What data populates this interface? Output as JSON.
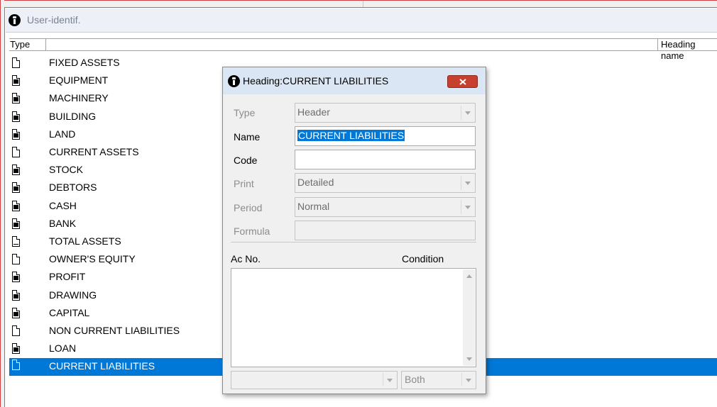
{
  "window": {
    "title": "User-identif."
  },
  "list": {
    "columns": {
      "type": "Type",
      "heading_name": "Heading name"
    },
    "rows": [
      {
        "label": "FIXED ASSETS",
        "icon": "header-doc-icon"
      },
      {
        "label": "EQUIPMENT",
        "icon": "detail-doc-icon"
      },
      {
        "label": "MACHINERY",
        "icon": "detail-doc-icon"
      },
      {
        "label": "BUILDING",
        "icon": "detail-doc-icon"
      },
      {
        "label": "LAND",
        "icon": "detail-doc-icon"
      },
      {
        "label": "CURRENT ASSETS",
        "icon": "header-doc-icon"
      },
      {
        "label": "STOCK",
        "icon": "detail-doc-icon"
      },
      {
        "label": "DEBTORS",
        "icon": "detail-doc-icon"
      },
      {
        "label": "CASH",
        "icon": "detail-doc-icon"
      },
      {
        "label": "BANK",
        "icon": "detail-doc-icon"
      },
      {
        "label": "TOTAL ASSETS",
        "icon": "total-doc-icon"
      },
      {
        "label": "OWNER'S EQUITY",
        "icon": "header-doc-icon"
      },
      {
        "label": "PROFIT",
        "icon": "detail-doc-icon"
      },
      {
        "label": "DRAWING",
        "icon": "detail-doc-icon"
      },
      {
        "label": "CAPITAL",
        "icon": "detail-doc-icon"
      },
      {
        "label": "NON CURRENT LIABILITIES",
        "icon": "header-doc-icon"
      },
      {
        "label": "LOAN",
        "icon": "detail-doc-icon"
      },
      {
        "label": "CURRENT LIABILITIES",
        "icon": "header-doc-icon",
        "selected": true
      }
    ]
  },
  "dialog": {
    "title": "Heading:CURRENT LIABILITIES",
    "close_icon": "close-icon",
    "fields": {
      "type": {
        "label": "Type",
        "value": "Header"
      },
      "name": {
        "label": "Name",
        "value": "CURRENT LIABILITIES"
      },
      "code": {
        "label": "Code",
        "value": ""
      },
      "print": {
        "label": "Print",
        "value": "Detailed"
      },
      "period": {
        "label": "Period",
        "value": "Normal"
      },
      "formula": {
        "label": "Formula",
        "value": ""
      }
    },
    "accounts": {
      "ac_no_label": "Ac No.",
      "condition_label": "Condition",
      "account_select_value": "",
      "condition_select_value": "Both"
    }
  },
  "colors": {
    "selection": "#0078d7",
    "close_button": "#c7402e",
    "dialog_title_bg": "#dbe6f4",
    "disabled_text": "#8c8c8c"
  }
}
